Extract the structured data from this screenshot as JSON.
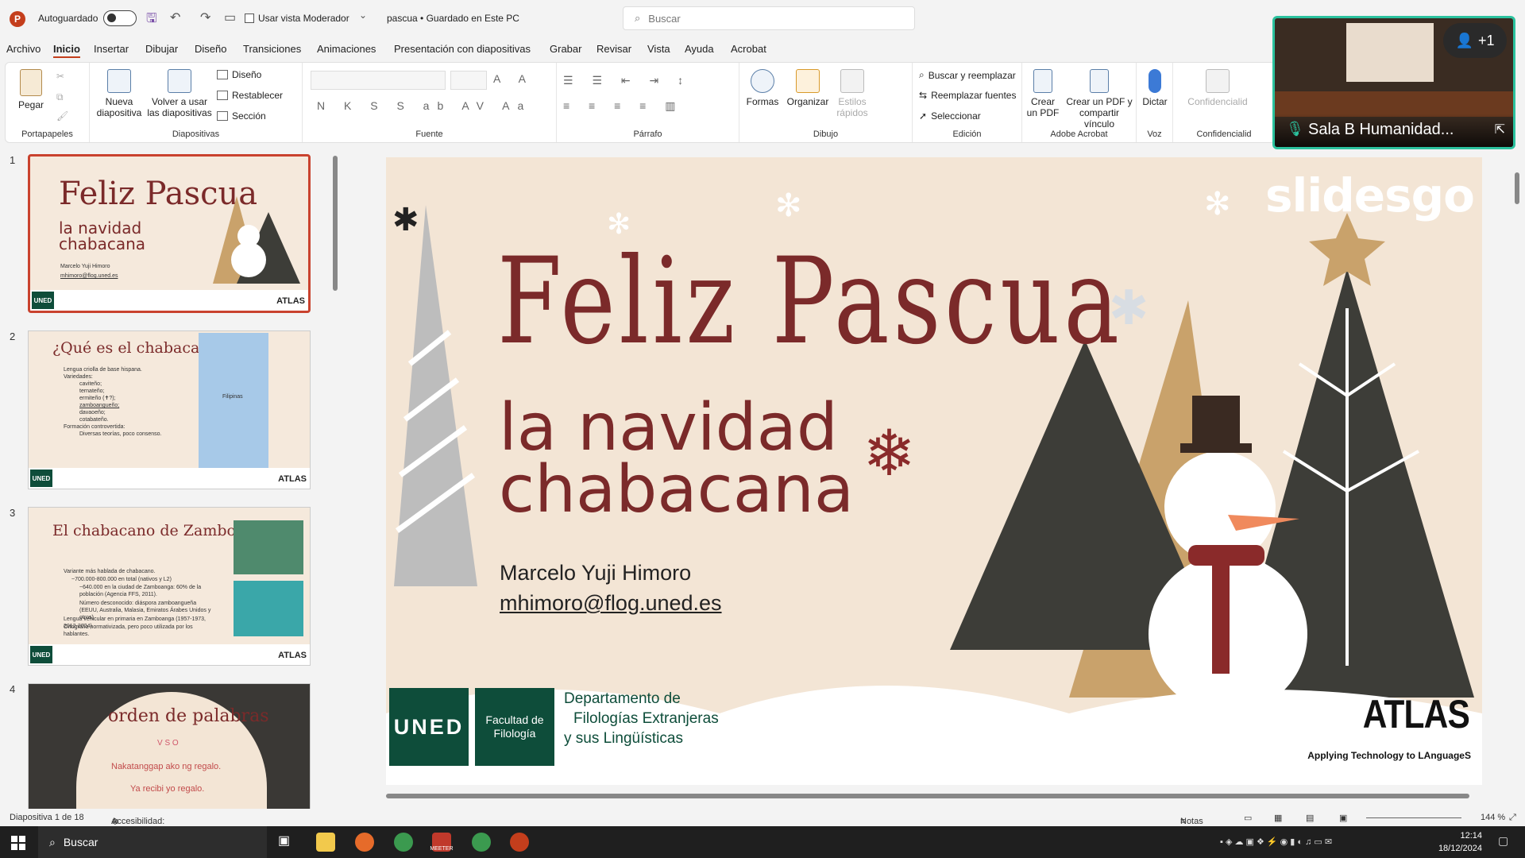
{
  "titlebar": {
    "app_icon": "P",
    "autosave_label": "Autoguardado",
    "moderator_label": "Usar vista Moderador",
    "document": "pascua • Guardado en Este PC",
    "search_placeholder": "Buscar"
  },
  "menu": [
    "Archivo",
    "Inicio",
    "Insertar",
    "Dibujar",
    "Diseño",
    "Transiciones",
    "Animaciones",
    "Presentación con diapositivas",
    "Grabar",
    "Revisar",
    "Vista",
    "Ayuda",
    "Acrobat"
  ],
  "ribbon": {
    "portapapeles": {
      "paste": "Pegar",
      "label": "Portapapeles"
    },
    "diapositivas": {
      "new": "Nueva diapositiva",
      "reuse": "Volver a usar las diapositivas",
      "layout": "Diseño",
      "reset": "Restablecer",
      "section": "Sección",
      "label": "Diapositivas"
    },
    "fuente": {
      "label": "Fuente",
      "glyphs": "N K S S ab AV Aa"
    },
    "parrafo": {
      "label": "Párrafo"
    },
    "dibujo": {
      "shapes": "Formas",
      "arrange": "Organizar",
      "quick": "Estilos rápidos",
      "label": "Dibujo"
    },
    "edicion": {
      "find": "Buscar y reemplazar",
      "fonts": "Reemplazar fuentes",
      "select": "Seleccionar",
      "label": "Edición"
    },
    "acrobat": {
      "create": "Crear un PDF",
      "share": "Crear un PDF y compartir vínculo",
      "label": "Adobe Acrobat"
    },
    "voz": {
      "dictate": "Dictar",
      "label": "Voz"
    },
    "conf": {
      "btn": "Confidencialid",
      "label": "Confidencialid"
    }
  },
  "thumbnails": [
    {
      "num": "1",
      "title": "Feliz Pascua",
      "sub": "la navidad chabacana",
      "author": "Marcelo Yuji Himoro",
      "email": "mhimoro@flog.uned.es"
    },
    {
      "num": "2",
      "title": "¿Qué es el chabacano?",
      "lines": [
        "Lengua criolla de base hispana.",
        "Variedades:",
        "caviteño;",
        "ternateño;",
        "ermiteño (✝?);",
        "zamboangueño;",
        "davaoeño;",
        "cotabateño.",
        "Formación controvertida:",
        "Diversas teorías, poco consenso."
      ],
      "map_label": "Filipinas"
    },
    {
      "num": "3",
      "title": "El chabacano de Zamboanga",
      "lines": [
        "Variante más hablada de chabacano.",
        "~700.000-800.000 en total (nativos y L2)",
        "~640.000 en la ciudad de Zamboanga: 60% de la población (Agencia FFS, 2011).",
        "Número desconocido: diáspora zamboangueña (EEUU, Australia, Malasia, Emiratos Árabes Unidos y otros).",
        "Lengua vehicular en primaria en Zamboanga (1957-1973, 2012-2024).",
        "Ortografía normativizada, pero poco utilizada por los hablantes."
      ]
    },
    {
      "num": "4",
      "title": "orden de palabras",
      "vso": "V S O",
      "line1": "Nakatanggap ako ng regalo.",
      "line2": "Ya recibi yo regalo."
    }
  ],
  "slide": {
    "title": "Feliz Pascua",
    "sub1": "la navidad",
    "sub2": "chabacana",
    "author": "Marcelo Yuji Himoro",
    "email": "mhimoro@flog.uned.es",
    "watermark": "slidesgo",
    "uned": "UNED",
    "facultad": "Facultad de Filología",
    "depto1": "Departamento de",
    "depto2": "Filologías Extranjeras",
    "depto3": "y sus Lingüísticas",
    "atlas": "ATLAS",
    "atlas_sub": "Applying Technology to LAnguageS",
    "colors": {
      "title": "#7b2a2a",
      "bg": "#f3e5d5",
      "tree_dark": "#3d3d38",
      "tree_gold": "#c9a26b",
      "uned": "#0e4d3a"
    }
  },
  "status": {
    "slide": "Diapositiva 1 de 18",
    "accessibility": "Accesibilidad: es necesario investigar",
    "notes": "Notas",
    "zoom": "144 %"
  },
  "taskbar": {
    "search": "Buscar",
    "time": "12:14",
    "date": "18/12/2024",
    "meeter": "MEETER"
  },
  "video": {
    "room": "Sala B Humanidad...",
    "participants": "+1"
  }
}
